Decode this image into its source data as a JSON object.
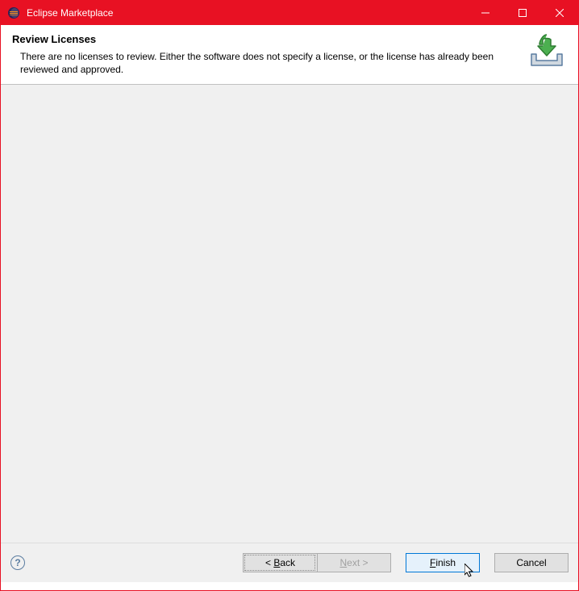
{
  "titlebar": {
    "title": "Eclipse Marketplace"
  },
  "header": {
    "title": "Review Licenses",
    "description": "There are no licenses to review.  Either the software does not specify a license, or the license has already been reviewed and approved."
  },
  "footer": {
    "back_label": "< Back",
    "next_label": "Next >",
    "finish_label": "Finish",
    "cancel_label": "Cancel"
  }
}
